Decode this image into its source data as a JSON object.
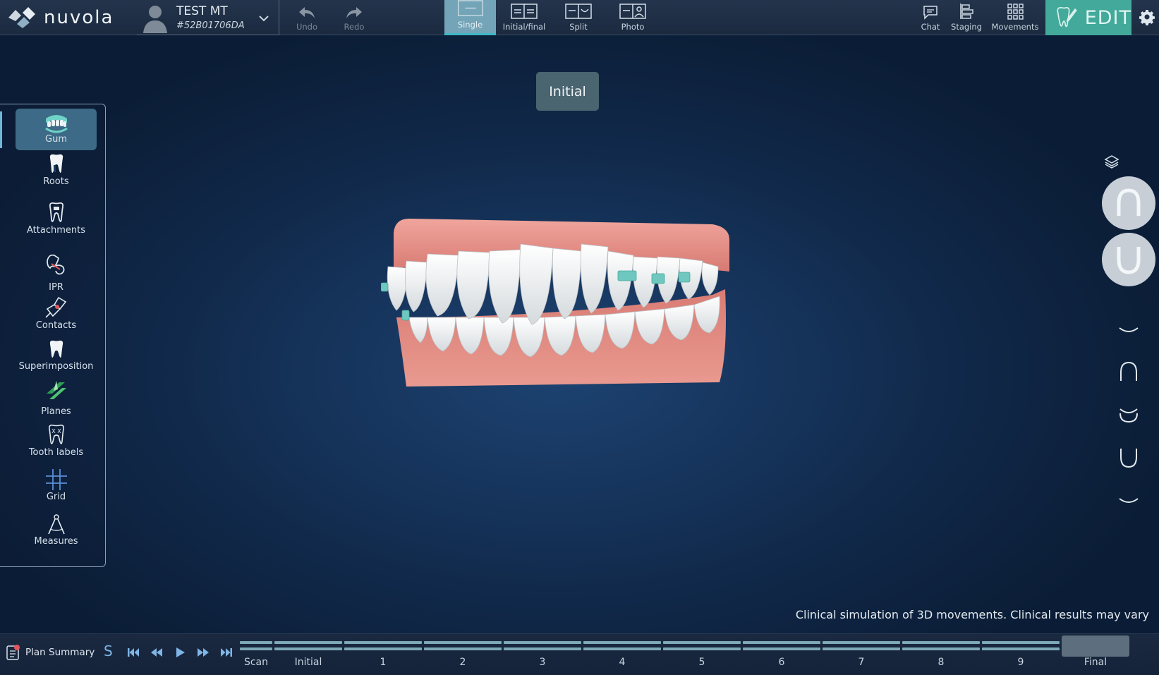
{
  "brand": {
    "name": "nuvola"
  },
  "patient": {
    "name": "TEST MT",
    "id": "#52B01706DA"
  },
  "toolbar": {
    "undo": "Undo",
    "redo": "Redo",
    "views": [
      "Single",
      "Initial/final",
      "Split",
      "Photo"
    ],
    "active_view": "Single",
    "chat": "Chat",
    "staging": "Staging",
    "movements": "Movements",
    "edit": "EDIT"
  },
  "tools": [
    {
      "label": "Gum",
      "icon": "gum-icon",
      "active": true
    },
    {
      "label": "Roots",
      "icon": "roots-icon"
    },
    {
      "label": "Attachments",
      "icon": "attachments-icon"
    },
    {
      "label": "IPR",
      "icon": "ipr-icon"
    },
    {
      "label": "Contacts",
      "icon": "contacts-icon"
    },
    {
      "label": "Superimposition",
      "icon": "superimposition-icon"
    },
    {
      "label": "Planes",
      "icon": "planes-icon"
    },
    {
      "label": "Tooth labels",
      "icon": "tooth-labels-icon"
    },
    {
      "label": "Grid",
      "icon": "grid-icon"
    },
    {
      "label": "Measures",
      "icon": "measures-icon"
    }
  ],
  "viewport": {
    "stage_label": "Initial",
    "disclaimer": "Clinical simulation of 3D movements. Clinical results may vary"
  },
  "playback": {
    "plan_summary": "Plan Summary",
    "s_label": "S",
    "timeline": [
      "Scan",
      "Initial",
      "1",
      "2",
      "3",
      "4",
      "5",
      "6",
      "7",
      "8",
      "9",
      "Final"
    ],
    "current_stage": "Final"
  },
  "colors": {
    "accent": "#43a99b",
    "active_view": "#74a4b7",
    "timeline_bar": "#7ea9b6",
    "gum": "#e58d84",
    "attachment": "#6fc8c0"
  }
}
